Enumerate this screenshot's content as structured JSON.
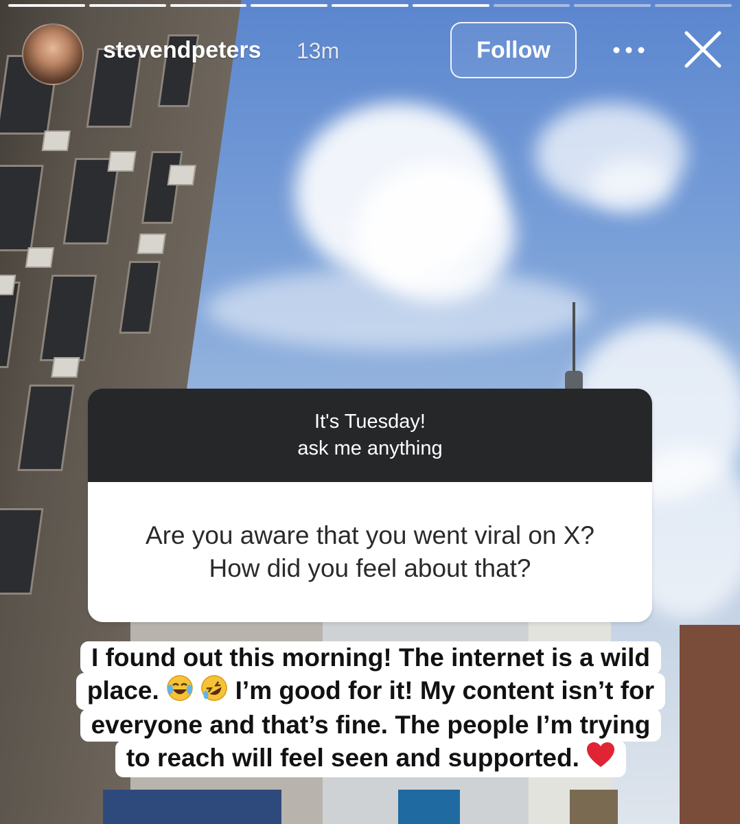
{
  "story": {
    "username": "stevendpeters",
    "time_ago": "13m",
    "follow_label": "Follow",
    "progress_total": 9,
    "progress_active": 6
  },
  "question": {
    "prompt_line1": "It's Tuesday!",
    "prompt_line2": "ask me anything",
    "text_line1": "Are you aware that you went viral on X?",
    "text_line2": "How did you feel about that?"
  },
  "answer": {
    "line1": "I found out this morning! The internet is a wild",
    "line2_a": "place.",
    "line2_b": "I’m good for it! My content isn’t for",
    "line3": "everyone and that’s fine. The people I’m trying",
    "line4": "to reach will feel seen and supported.",
    "emojis": [
      "face-with-tears-of-joy",
      "rolling-on-floor-laughing",
      "red-heart"
    ]
  }
}
